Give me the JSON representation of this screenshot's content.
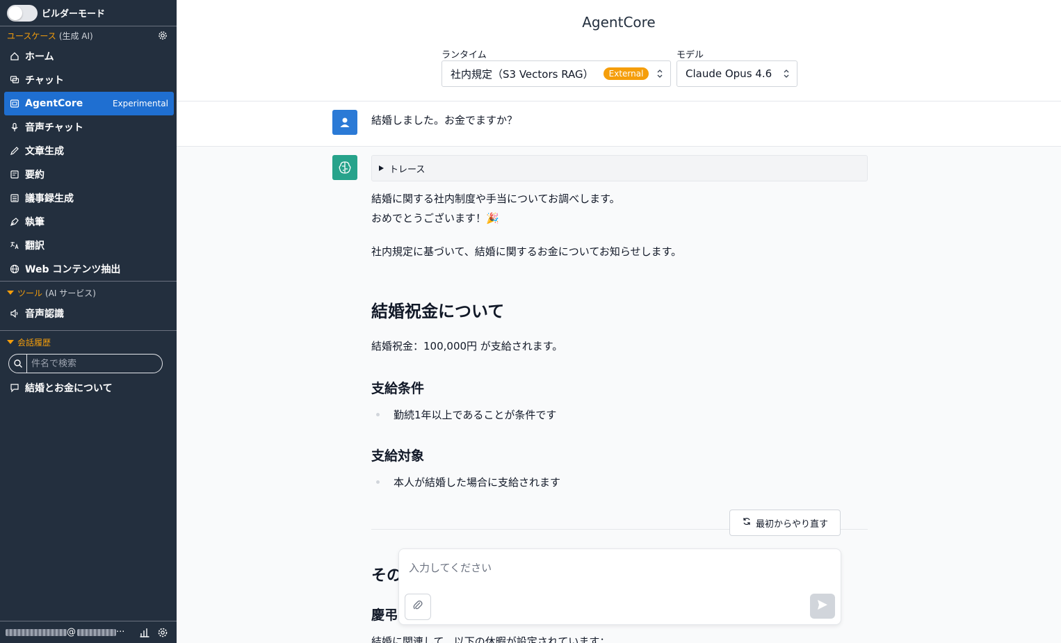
{
  "sidebar": {
    "builder_mode_label": "ビルダーモード",
    "usecase_section": {
      "title": "ユースケース",
      "subtitle": "(生成 AI)"
    },
    "nav_items": [
      {
        "label": "ホーム",
        "icon": "home-icon"
      },
      {
        "label": "チャット",
        "icon": "chat-icon"
      },
      {
        "label": "AgentCore",
        "icon": "agent-icon",
        "badge": "Experimental",
        "active": true
      },
      {
        "label": "音声チャット",
        "icon": "mic-icon"
      },
      {
        "label": "文章生成",
        "icon": "pencil-icon"
      },
      {
        "label": "要約",
        "icon": "summary-icon"
      },
      {
        "label": "議事録生成",
        "icon": "minutes-icon"
      },
      {
        "label": "執筆",
        "icon": "pen-nib-icon"
      },
      {
        "label": "翻訳",
        "icon": "translate-icon"
      },
      {
        "label": "Web コンテンツ抽出",
        "icon": "globe-icon"
      }
    ],
    "tools_section": {
      "title": "ツール",
      "subtitle": "(AI サービス)"
    },
    "tools_items": [
      {
        "label": "音声認識",
        "icon": "speaker-icon"
      }
    ],
    "history_section": {
      "title": "会話履歴"
    },
    "search": {
      "placeholder": "件名で検索",
      "value": ""
    },
    "history_items": [
      {
        "label": "結婚とお金について"
      }
    ],
    "footer": {
      "email_at": "@",
      "email_ellipsis": "···"
    }
  },
  "header": {
    "title": "AgentCore",
    "runtime": {
      "label": "ランタイム",
      "value": "社内規定（S3 Vectors RAG）",
      "badge": "External"
    },
    "model": {
      "label": "モデル",
      "value": "Claude Opus 4.6"
    }
  },
  "chat": {
    "user_message": "結婚しました。お金でますか？",
    "trace_label": "トレース",
    "assistant": {
      "intro_line1": "結婚に関する社内制度や手当についてお調べします。",
      "intro_line2": "おめでとうございます！🎉",
      "intro_line3": "社内規定に基づいて、結婚に関するお金についてお知らせします。",
      "h2_1": "結婚祝金について",
      "p_1": "結婚祝金：100,000円 が支給されます。",
      "h3_1": "支給条件",
      "bullet_1": "勤続1年以上であることが条件です",
      "h3_2": "支給対象",
      "bullet_2": "本人が結婚した場合に支給されます",
      "partial_h2": "その",
      "partial_h3": "慶弔",
      "partial_p": "結婚に関連して、以下の休暇が設定されています："
    },
    "restart_label": "最初からやり直す",
    "input_placeholder": "入力してください",
    "input_value": ""
  }
}
